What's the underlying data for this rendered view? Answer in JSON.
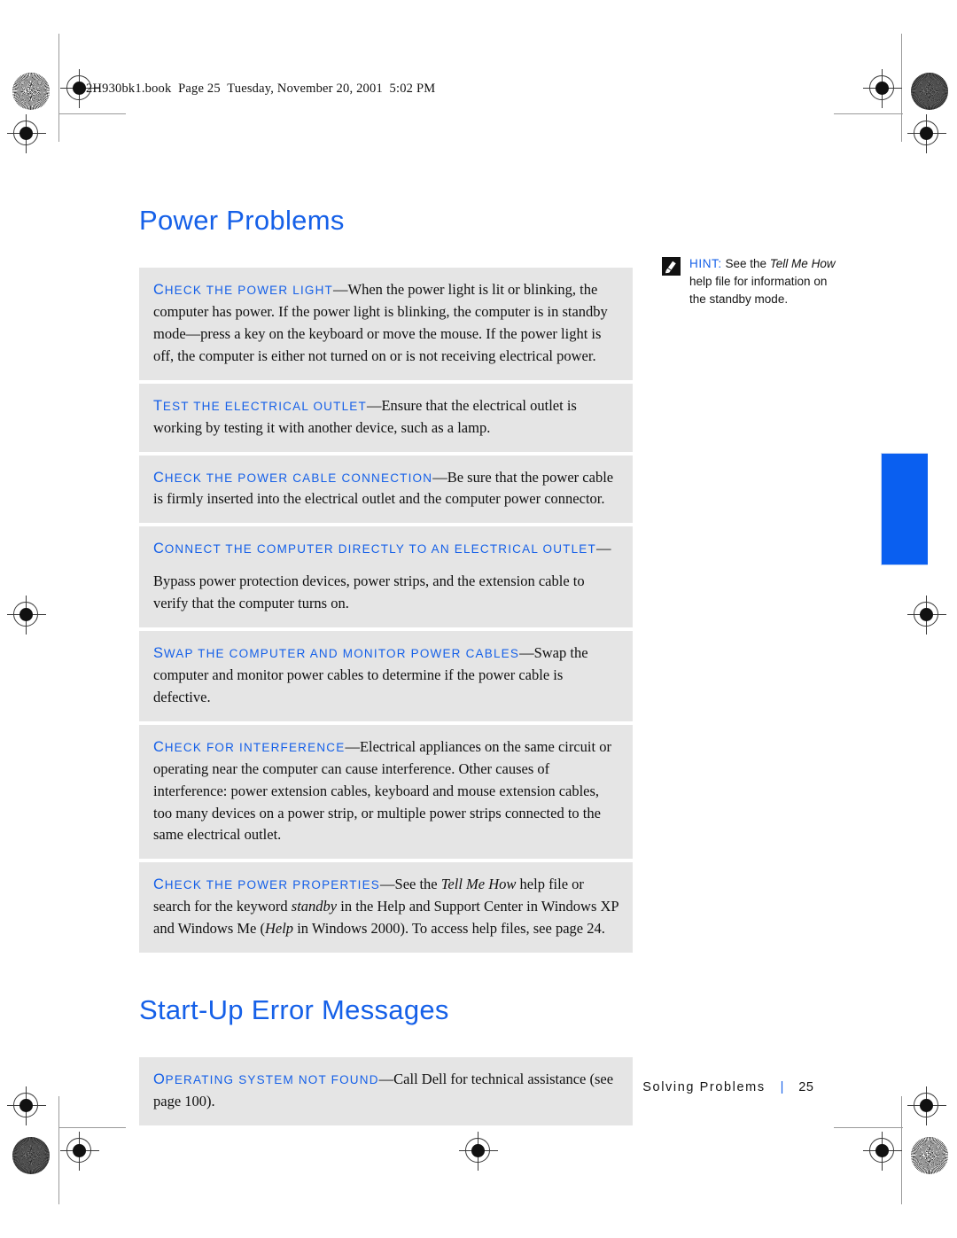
{
  "header": {
    "text": "2H930bk1.book  Page 25  Tuesday, November 20, 2001  5:02 PM"
  },
  "sections": [
    {
      "title": "Power Problems",
      "tips": [
        {
          "lead_cap": "C",
          "lead_rest": "HECK THE POWER LIGHT",
          "lead_on_own_line": false,
          "body": "When the power light is lit or blinking, the computer has power. If the power light is blinking, the computer is in standby mode—press a key on the keyboard or move the mouse. If the power light is off, the computer is either not turned on or is not receiving electrical power."
        },
        {
          "lead_cap": "T",
          "lead_rest": "EST THE ELECTRICAL OUTLET",
          "lead_on_own_line": false,
          "body": "Ensure that the electrical outlet is working by testing it with another device, such as a lamp."
        },
        {
          "lead_cap": "C",
          "lead_rest": "HECK THE POWER CABLE CONNECTION",
          "lead_on_own_line": false,
          "body": "Be sure that the power cable is firmly inserted into the electrical outlet and the computer power connector."
        },
        {
          "lead_cap": "C",
          "lead_rest": "ONNECT THE COMPUTER DIRECTLY TO AN ELECTRICAL OUTLET",
          "lead_on_own_line": true,
          "body": "Bypass power protection devices, power strips, and the extension cable to verify that the computer turns on."
        },
        {
          "lead_cap": "S",
          "lead_rest": "WAP THE COMPUTER AND MONITOR POWER CABLES",
          "lead_on_own_line": false,
          "body": "Swap the computer and monitor power cables to determine if the power cable is defective."
        },
        {
          "lead_cap": "C",
          "lead_rest": "HECK FOR INTERFERENCE",
          "lead_on_own_line": false,
          "body": "Electrical appliances on the same circuit or operating near the computer can cause interference. Other causes of interference: power extension cables, keyboard and mouse extension cables, too many devices on a power strip, or multiple power strips connected to the same electrical outlet."
        },
        {
          "lead_cap": "C",
          "lead_rest": "HECK THE POWER PROPERTIES",
          "lead_on_own_line": false,
          "body_parts": [
            {
              "text": "See the ",
              "italic": false
            },
            {
              "text": "Tell Me How",
              "italic": true
            },
            {
              "text": " help file or search for the keyword ",
              "italic": false
            },
            {
              "text": "standby",
              "italic": true
            },
            {
              "text": " in the Help and Support Center in Windows XP and Windows Me (",
              "italic": false
            },
            {
              "text": "Help",
              "italic": true
            },
            {
              "text": " in Windows 2000). To access help files, see page 24.",
              "italic": false
            }
          ]
        }
      ]
    },
    {
      "title": "Start-Up Error Messages",
      "tips": [
        {
          "lead_cap": "O",
          "lead_rest": "PERATING SYSTEM NOT FOUND",
          "lead_on_own_line": false,
          "body": "Call Dell for technical assistance (see page 100)."
        }
      ]
    }
  ],
  "hint": {
    "label": "HINT:",
    "icon": "pencil-note-icon",
    "parts": [
      {
        "text": " See the ",
        "italic": false
      },
      {
        "text": "Tell Me How",
        "italic": true
      },
      {
        "text": " help file for information on the standby mode.",
        "italic": false
      }
    ]
  },
  "footer": {
    "chapter": "Solving Problems",
    "separator": "|",
    "page_number": "25"
  },
  "colors": {
    "accent_blue": "#1560e8",
    "tab_blue": "#0a5ff0",
    "tip_background": "#e5e5e5",
    "body_text": "#101010"
  },
  "thumb_tab": {
    "name": "chapter-thumb-tab"
  }
}
